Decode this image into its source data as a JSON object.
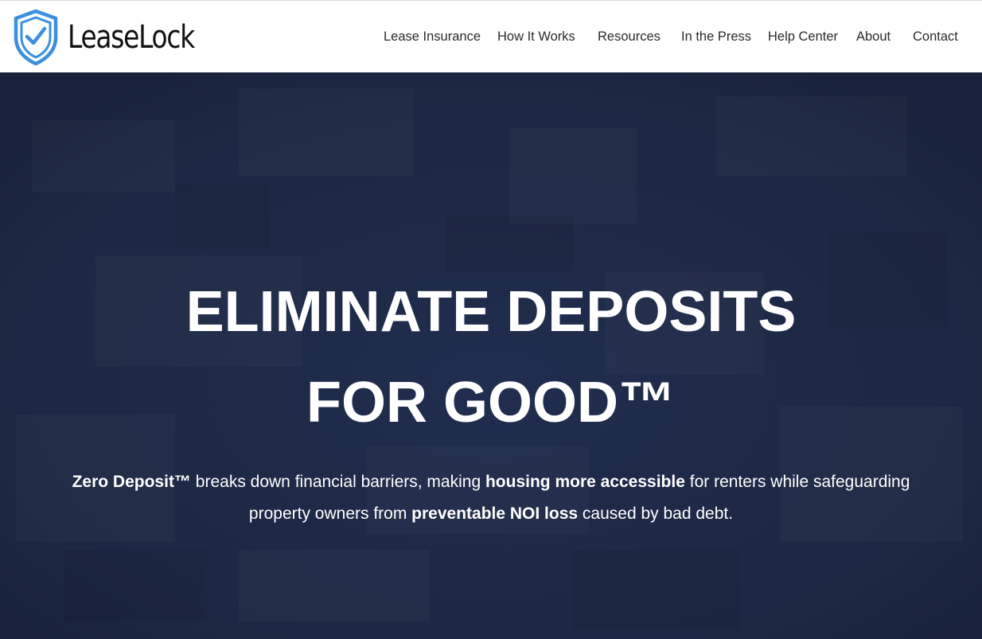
{
  "brand": {
    "name": "LeaseLock",
    "icon": "shield-check-icon",
    "icon_color": "#3b8fde"
  },
  "nav": {
    "items": [
      {
        "label": "Lease Insurance"
      },
      {
        "label": "How It Works"
      },
      {
        "label": "Resources"
      },
      {
        "label": "In the Press"
      },
      {
        "label": "Help Center"
      },
      {
        "label": "About"
      },
      {
        "label": "Contact"
      }
    ]
  },
  "hero": {
    "background_color": "#1d2944",
    "title_line1": "ELIMINATE DEPOSITS",
    "title_line2": "FOR GOOD™",
    "sub_line1": {
      "b1": "Zero Deposit™",
      "t1": " breaks down financial barriers, making ",
      "b2": "housing more accessible",
      "t2": " for renters while safeguarding"
    },
    "sub_line2": {
      "t1": "property owners from ",
      "b1": "preventable NOI loss",
      "t2": " caused by bad debt."
    }
  }
}
